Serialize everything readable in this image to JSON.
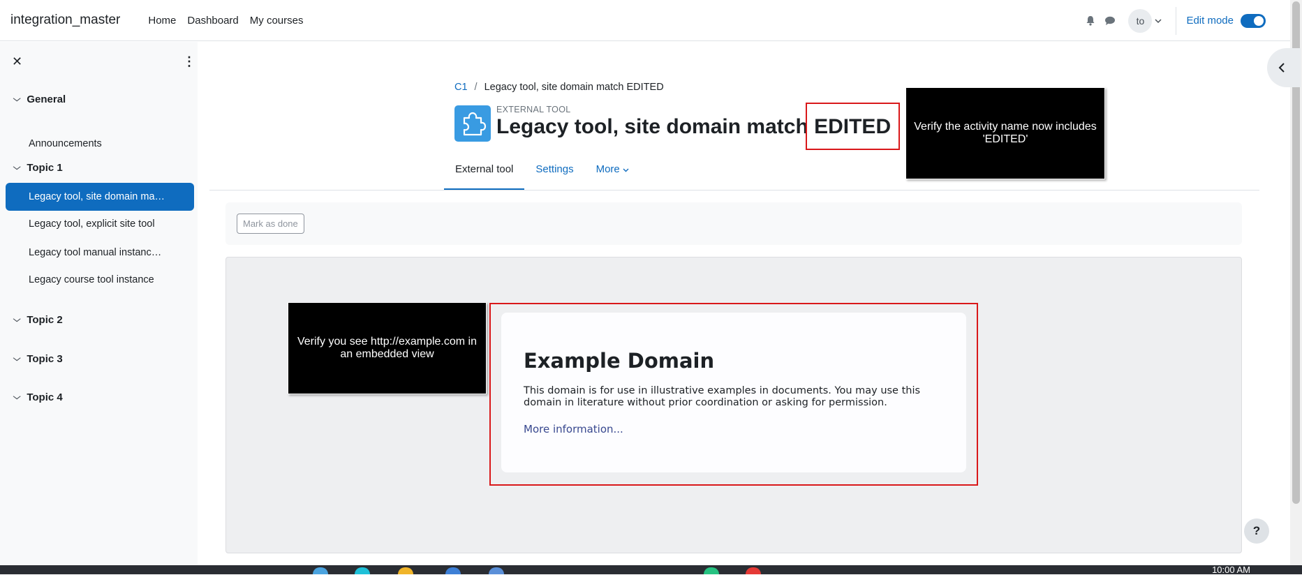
{
  "navbar": {
    "brand": "integration_master",
    "links": [
      "Home",
      "Dashboard",
      "My courses"
    ],
    "avatar_initials": "to",
    "edit_mode_label": "Edit mode",
    "edit_mode_on": true
  },
  "sidebar": {
    "sections": [
      {
        "title": "General",
        "items": [
          "Announcements"
        ]
      },
      {
        "title": "Topic 1",
        "items": [
          "Legacy tool, site domain ma…",
          "Legacy tool, explicit site tool",
          "Legacy tool manual instanc…",
          "Legacy course tool instance"
        ]
      },
      {
        "title": "Topic 2",
        "items": []
      },
      {
        "title": "Topic 3",
        "items": []
      },
      {
        "title": "Topic 4",
        "items": []
      }
    ],
    "active_item": "Legacy tool, site domain ma…"
  },
  "breadcrumb": {
    "course": "C1",
    "current": "Legacy tool, site domain match EDITED"
  },
  "activity": {
    "type_label": "EXTERNAL TOOL",
    "title": "Legacy tool, site domain match EDITED"
  },
  "tabs": {
    "external_tool": "External tool",
    "settings": "Settings",
    "more": "More"
  },
  "completion": {
    "mark_done_label": "Mark as done"
  },
  "embedded_page": {
    "heading": "Example Domain",
    "body": "This domain is for use in illustrative examples in documents. You may use this domain in literature without prior coordination or asking for permission.",
    "link": "More information..."
  },
  "callouts": {
    "edited_note": "Verify the activity name now includes 'EDITED'",
    "embed_note": "Verify you see http://example.com in an embedded view"
  },
  "help_label": "?",
  "taskbar": {
    "time": "10:00 AM"
  },
  "colors": {
    "accent": "#0f6cbf",
    "activity_icon": "#399be2",
    "highlight_border": "#d9181a"
  }
}
